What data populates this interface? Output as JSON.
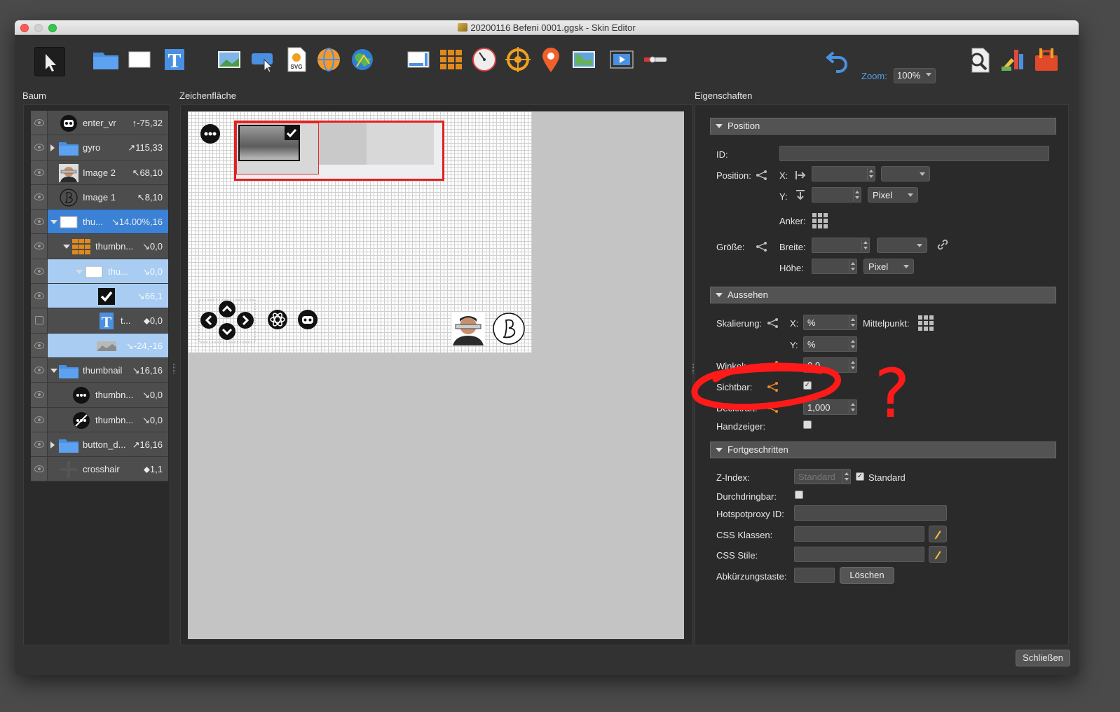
{
  "window": {
    "title": "20200116 Befeni 0001.ggsk - Skin Editor"
  },
  "toolbar": {
    "tools": [
      {
        "name": "select-tool",
        "icon": "pointer-icon"
      },
      {
        "name": "container-tool",
        "icon": "folder-icon"
      },
      {
        "name": "rectangle-tool",
        "icon": "rectangle-icon"
      },
      {
        "name": "text-tool",
        "icon": "text-icon"
      },
      {
        "name": "image-tool",
        "icon": "image-icon"
      },
      {
        "name": "button-tool",
        "icon": "button-icon"
      },
      {
        "name": "svg-tool",
        "icon": "svg-icon",
        "label": "SVG"
      },
      {
        "name": "hotspot-tool",
        "icon": "globe-icon"
      },
      {
        "name": "map-tool",
        "icon": "map-globe-icon"
      },
      {
        "name": "scrollarea-tool",
        "icon": "scrollarea-icon"
      },
      {
        "name": "cloner-tool",
        "icon": "grid-icon"
      },
      {
        "name": "compass-tool",
        "icon": "compass-icon"
      },
      {
        "name": "target-tool",
        "icon": "target-icon"
      },
      {
        "name": "marker-tool",
        "icon": "pin-icon"
      },
      {
        "name": "map-tool-2",
        "icon": "map-icon"
      },
      {
        "name": "video-tool",
        "icon": "video-icon"
      },
      {
        "name": "timeline-tool",
        "icon": "timeline-icon"
      }
    ],
    "zoom_label": "Zoom:",
    "zoom_value": "100%"
  },
  "panels": {
    "tree_title": "Baum",
    "canvas_title": "Zeichenfläche",
    "props_title": "Eigenschaften"
  },
  "tree": {
    "rows": [
      {
        "label": "enter_vr",
        "pos": "↑-75,32",
        "icon": "robot-icon",
        "state": "normal",
        "indent": 1,
        "disclosure": "none",
        "visible": true
      },
      {
        "label": "gyro",
        "pos": "↗115,33",
        "icon": "folder-icon",
        "state": "normal",
        "indent": 1,
        "disclosure": "closed",
        "visible": true
      },
      {
        "label": "Image 2",
        "pos": "↖68,10",
        "icon": "photo-person-icon",
        "state": "normal",
        "indent": 1,
        "disclosure": "none",
        "visible": true
      },
      {
        "label": "Image 1",
        "pos": "↖8,10",
        "icon": "logo-b-icon",
        "state": "normal",
        "indent": 1,
        "disclosure": "none",
        "visible": true
      },
      {
        "label": "thu...",
        "pos": "↘14.00%,16",
        "icon": "rectangle-icon",
        "state": "sel-dark",
        "indent": 1,
        "disclosure": "open",
        "visible": true
      },
      {
        "label": "thumbn...",
        "pos": "↘0,0",
        "icon": "cloner-icon",
        "state": "normal",
        "indent": 2,
        "disclosure": "open",
        "visible": true
      },
      {
        "label": "thu...",
        "pos": "↘0,0",
        "icon": "rectangle-icon",
        "state": "sel-light",
        "indent": 3,
        "disclosure": "open",
        "visible": true
      },
      {
        "label": "",
        "pos": "↘66,1",
        "icon": "checkbox-icon",
        "state": "sel-light",
        "indent": 4,
        "disclosure": "none",
        "visible": true
      },
      {
        "label": "t...",
        "pos": "⬥0,0",
        "icon": "text-icon",
        "state": "normal",
        "indent": 4,
        "disclosure": "none",
        "visible": false
      },
      {
        "label": "",
        "pos": "↘-24,-16",
        "icon": "thumbnail-image-icon",
        "state": "sel-light",
        "indent": 4,
        "disclosure": "none",
        "visible": true
      },
      {
        "label": "thumbnail",
        "pos": "↘16,16",
        "icon": "folder-icon",
        "state": "normal",
        "indent": 1,
        "disclosure": "open",
        "visible": true
      },
      {
        "label": "thumbn...",
        "pos": "↘0,0",
        "icon": "dots-icon",
        "state": "normal",
        "indent": 2,
        "disclosure": "none",
        "visible": true
      },
      {
        "label": "thumbn...",
        "pos": "↘0,0",
        "icon": "dots-off-icon",
        "state": "normal",
        "indent": 2,
        "disclosure": "none",
        "visible": true
      },
      {
        "label": "button_d...",
        "pos": "↗16,16",
        "icon": "folder-icon",
        "state": "normal",
        "indent": 1,
        "disclosure": "closed",
        "visible": true
      },
      {
        "label": "crosshair",
        "pos": "⬥1,1",
        "icon": "crosshair-icon",
        "state": "normal",
        "indent": 1,
        "disclosure": "none",
        "visible": true
      }
    ]
  },
  "props": {
    "position_section": "Position",
    "id_label": "ID:",
    "id_value": "",
    "position_label": "Position:",
    "x_label": "X:",
    "y_label": "Y:",
    "pos_y_unit": "Pixel",
    "anchor_label": "Anker:",
    "size_label": "Größe:",
    "width_label": "Breite:",
    "height_label": "Höhe:",
    "size_height_unit": "Pixel",
    "appearance_section": "Aussehen",
    "scale_label": "Skalierung:",
    "scale_x": "%",
    "scale_y": "%",
    "center_label": "Mittelpunkt:",
    "angle_label": "Winkel:",
    "angle_value": "0,0",
    "visible_label": "Sichtbar:",
    "opacity_label": "Deckkraft:",
    "opacity_value": "1,000",
    "handcursor_label": "Handzeiger:",
    "advanced_section": "Fortgeschritten",
    "zindex_label": "Z-Index:",
    "zindex_value": "Standard",
    "zindex_default_label": "Standard",
    "permeable_label": "Durchdringbar:",
    "hotspotproxy_label": "Hotspotproxy ID:",
    "css_classes_label": "CSS Klassen:",
    "css_styles_label": "CSS Stile:",
    "shortcut_label": "Abkürzungstaste:",
    "clear_button": "Löschen"
  },
  "footer": {
    "close_button": "Schließen"
  },
  "annotation": {
    "mark": "?",
    "color": "#ff1a1a"
  },
  "colors": {
    "selection_dark": "#3b82d6",
    "selection_light": "#a9cdf2",
    "zoom_accent": "#4ea2e8",
    "share_orange": "#f08a24"
  }
}
